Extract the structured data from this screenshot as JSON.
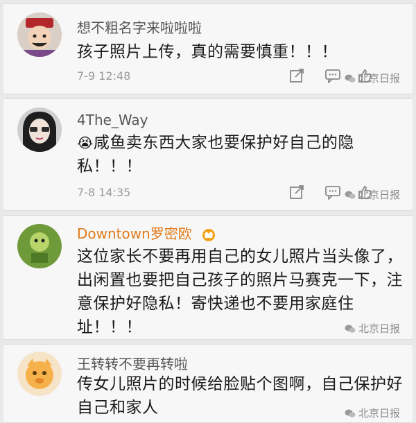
{
  "comments": [
    {
      "username": "想不粗名字来啦啦啦",
      "text": "孩子照片上传，真的需要慎重！！！",
      "timestamp": "7-9 12:48",
      "watermark": "北京日报"
    },
    {
      "username": "4The_Way",
      "emoji": "😭",
      "text": "咸鱼卖东西大家也要保护好自己的隐私！！！",
      "timestamp": "7-8 14:35",
      "watermark": "北京日报"
    },
    {
      "username": "Downtown罗密欧",
      "text": "这位家长不要再用自己的女儿照片当头像了，出闲置也要把自己孩子的照片马赛克一下，注意保护好隐私！寄快递也不要用家庭住址！！！",
      "watermark": "北京日报"
    },
    {
      "username": "王转转不要再转啦",
      "text": "传女儿照片的时候给脸贴个图啊，自己保护好自己和家人",
      "watermark": "北京日报"
    }
  ]
}
